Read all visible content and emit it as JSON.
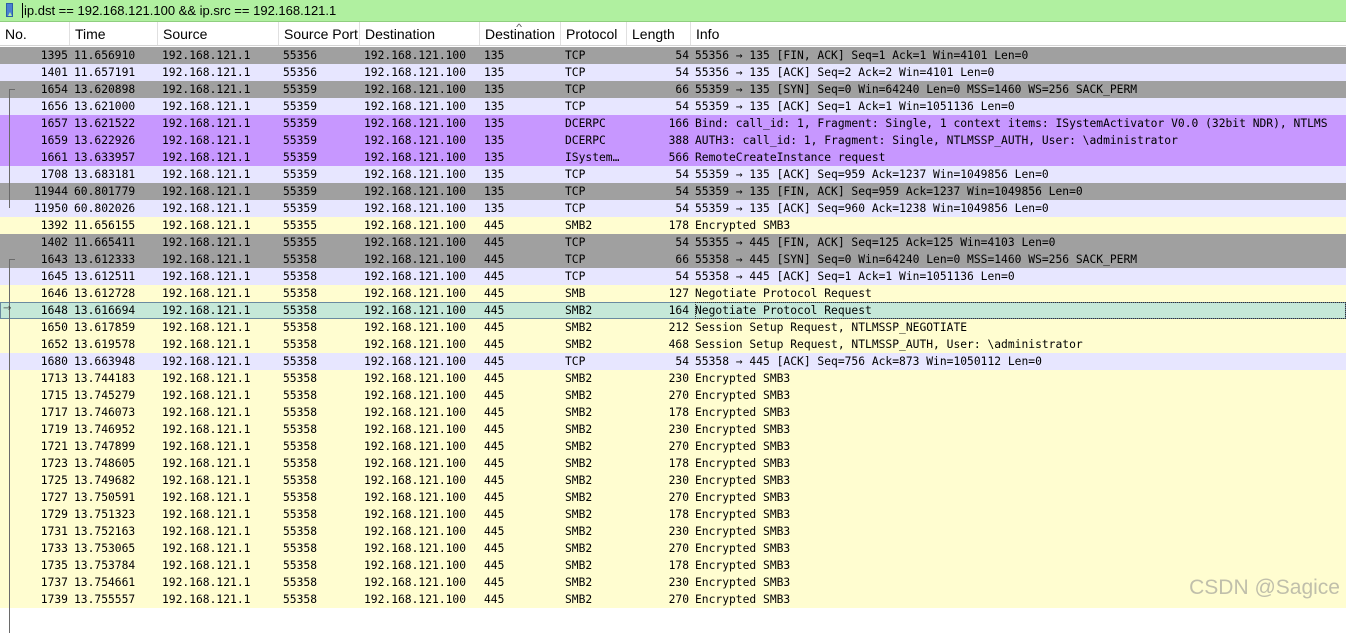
{
  "filter": {
    "text": "ip.dst == 192.168.121.100 && ip.src == 192.168.121.1",
    "icon": "bookmark-filter-icon",
    "background": "#b0f0a0"
  },
  "columns": [
    "No.",
    "Time",
    "Source",
    "Source Port",
    "Destination",
    "Destination",
    "Protocol",
    "Length",
    "Info"
  ],
  "colors": {
    "gray": "#a0a0a0",
    "lavender": "#e7e6ff",
    "purple": "#c797ff",
    "yellow": "#fffdd0",
    "selected": "#c5e8d8"
  },
  "rows": [
    {
      "no": "1395",
      "time": "11.656910",
      "src": "192.168.121.1",
      "sport": "55356",
      "dst": "192.168.121.100",
      "dport": "135",
      "proto": "TCP",
      "len": "54",
      "info": "55356 → 135 [FIN, ACK] Seq=1 Ack=1 Win=4101 Len=0",
      "color": "#a0a0a0"
    },
    {
      "no": "1401",
      "time": "11.657191",
      "src": "192.168.121.1",
      "sport": "55356",
      "dst": "192.168.121.100",
      "dport": "135",
      "proto": "TCP",
      "len": "54",
      "info": "55356 → 135 [ACK] Seq=2 Ack=2 Win=4101 Len=0",
      "color": "#e7e6ff"
    },
    {
      "no": "1654",
      "time": "13.620898",
      "src": "192.168.121.1",
      "sport": "55359",
      "dst": "192.168.121.100",
      "dport": "135",
      "proto": "TCP",
      "len": "66",
      "info": "55359 → 135 [SYN] Seq=0 Win=64240 Len=0 MSS=1460 WS=256 SACK_PERM",
      "color": "#a0a0a0"
    },
    {
      "no": "1656",
      "time": "13.621000",
      "src": "192.168.121.1",
      "sport": "55359",
      "dst": "192.168.121.100",
      "dport": "135",
      "proto": "TCP",
      "len": "54",
      "info": "55359 → 135 [ACK] Seq=1 Ack=1 Win=1051136 Len=0",
      "color": "#e7e6ff"
    },
    {
      "no": "1657",
      "time": "13.621522",
      "src": "192.168.121.1",
      "sport": "55359",
      "dst": "192.168.121.100",
      "dport": "135",
      "proto": "DCERPC",
      "len": "166",
      "info": "Bind: call_id: 1, Fragment: Single, 1 context items: ISystemActivator V0.0 (32bit NDR), NTLMS",
      "color": "#c797ff"
    },
    {
      "no": "1659",
      "time": "13.622926",
      "src": "192.168.121.1",
      "sport": "55359",
      "dst": "192.168.121.100",
      "dport": "135",
      "proto": "DCERPC",
      "len": "388",
      "info": "AUTH3: call_id: 1, Fragment: Single, NTLMSSP_AUTH, User: \\administrator",
      "color": "#c797ff"
    },
    {
      "no": "1661",
      "time": "13.633957",
      "src": "192.168.121.1",
      "sport": "55359",
      "dst": "192.168.121.100",
      "dport": "135",
      "proto": "ISystem…",
      "len": "566",
      "info": "RemoteCreateInstance request",
      "color": "#c797ff"
    },
    {
      "no": "1708",
      "time": "13.683181",
      "src": "192.168.121.1",
      "sport": "55359",
      "dst": "192.168.121.100",
      "dport": "135",
      "proto": "TCP",
      "len": "54",
      "info": "55359 → 135 [ACK] Seq=959 Ack=1237 Win=1049856 Len=0",
      "color": "#e7e6ff"
    },
    {
      "no": "11944",
      "time": "60.801779",
      "src": "192.168.121.1",
      "sport": "55359",
      "dst": "192.168.121.100",
      "dport": "135",
      "proto": "TCP",
      "len": "54",
      "info": "55359 → 135 [FIN, ACK] Seq=959 Ack=1237 Win=1049856 Len=0",
      "color": "#a0a0a0"
    },
    {
      "no": "11950",
      "time": "60.802026",
      "src": "192.168.121.1",
      "sport": "55359",
      "dst": "192.168.121.100",
      "dport": "135",
      "proto": "TCP",
      "len": "54",
      "info": "55359 → 135 [ACK] Seq=960 Ack=1238 Win=1049856 Len=0",
      "color": "#e7e6ff"
    },
    {
      "no": "1392",
      "time": "11.656155",
      "src": "192.168.121.1",
      "sport": "55355",
      "dst": "192.168.121.100",
      "dport": "445",
      "proto": "SMB2",
      "len": "178",
      "info": "Encrypted SMB3",
      "color": "#fffdd0"
    },
    {
      "no": "1402",
      "time": "11.665411",
      "src": "192.168.121.1",
      "sport": "55355",
      "dst": "192.168.121.100",
      "dport": "445",
      "proto": "TCP",
      "len": "54",
      "info": "55355 → 445 [FIN, ACK] Seq=125 Ack=125 Win=4103 Len=0",
      "color": "#a0a0a0"
    },
    {
      "no": "1643",
      "time": "13.612333",
      "src": "192.168.121.1",
      "sport": "55358",
      "dst": "192.168.121.100",
      "dport": "445",
      "proto": "TCP",
      "len": "66",
      "info": "55358 → 445 [SYN] Seq=0 Win=64240 Len=0 MSS=1460 WS=256 SACK_PERM",
      "color": "#a0a0a0"
    },
    {
      "no": "1645",
      "time": "13.612511",
      "src": "192.168.121.1",
      "sport": "55358",
      "dst": "192.168.121.100",
      "dport": "445",
      "proto": "TCP",
      "len": "54",
      "info": "55358 → 445 [ACK] Seq=1 Ack=1 Win=1051136 Len=0",
      "color": "#e7e6ff"
    },
    {
      "no": "1646",
      "time": "13.612728",
      "src": "192.168.121.1",
      "sport": "55358",
      "dst": "192.168.121.100",
      "dport": "445",
      "proto": "SMB",
      "len": "127",
      "info": "Negotiate Protocol Request",
      "color": "#fffdd0"
    },
    {
      "no": "1648",
      "time": "13.616694",
      "src": "192.168.121.1",
      "sport": "55358",
      "dst": "192.168.121.100",
      "dport": "445",
      "proto": "SMB2",
      "len": "164",
      "info": "Negotiate Protocol Request",
      "color": "#c5e8d8",
      "selected": true
    },
    {
      "no": "1650",
      "time": "13.617859",
      "src": "192.168.121.1",
      "sport": "55358",
      "dst": "192.168.121.100",
      "dport": "445",
      "proto": "SMB2",
      "len": "212",
      "info": "Session Setup Request, NTLMSSP_NEGOTIATE",
      "color": "#fffdd0"
    },
    {
      "no": "1652",
      "time": "13.619578",
      "src": "192.168.121.1",
      "sport": "55358",
      "dst": "192.168.121.100",
      "dport": "445",
      "proto": "SMB2",
      "len": "468",
      "info": "Session Setup Request, NTLMSSP_AUTH, User: \\administrator",
      "color": "#fffdd0"
    },
    {
      "no": "1680",
      "time": "13.663948",
      "src": "192.168.121.1",
      "sport": "55358",
      "dst": "192.168.121.100",
      "dport": "445",
      "proto": "TCP",
      "len": "54",
      "info": "55358 → 445 [ACK] Seq=756 Ack=873 Win=1050112 Len=0",
      "color": "#e7e6ff"
    },
    {
      "no": "1713",
      "time": "13.744183",
      "src": "192.168.121.1",
      "sport": "55358",
      "dst": "192.168.121.100",
      "dport": "445",
      "proto": "SMB2",
      "len": "230",
      "info": "Encrypted SMB3",
      "color": "#fffdd0"
    },
    {
      "no": "1715",
      "time": "13.745279",
      "src": "192.168.121.1",
      "sport": "55358",
      "dst": "192.168.121.100",
      "dport": "445",
      "proto": "SMB2",
      "len": "270",
      "info": "Encrypted SMB3",
      "color": "#fffdd0"
    },
    {
      "no": "1717",
      "time": "13.746073",
      "src": "192.168.121.1",
      "sport": "55358",
      "dst": "192.168.121.100",
      "dport": "445",
      "proto": "SMB2",
      "len": "178",
      "info": "Encrypted SMB3",
      "color": "#fffdd0"
    },
    {
      "no": "1719",
      "time": "13.746952",
      "src": "192.168.121.1",
      "sport": "55358",
      "dst": "192.168.121.100",
      "dport": "445",
      "proto": "SMB2",
      "len": "230",
      "info": "Encrypted SMB3",
      "color": "#fffdd0"
    },
    {
      "no": "1721",
      "time": "13.747899",
      "src": "192.168.121.1",
      "sport": "55358",
      "dst": "192.168.121.100",
      "dport": "445",
      "proto": "SMB2",
      "len": "270",
      "info": "Encrypted SMB3",
      "color": "#fffdd0"
    },
    {
      "no": "1723",
      "time": "13.748605",
      "src": "192.168.121.1",
      "sport": "55358",
      "dst": "192.168.121.100",
      "dport": "445",
      "proto": "SMB2",
      "len": "178",
      "info": "Encrypted SMB3",
      "color": "#fffdd0"
    },
    {
      "no": "1725",
      "time": "13.749682",
      "src": "192.168.121.1",
      "sport": "55358",
      "dst": "192.168.121.100",
      "dport": "445",
      "proto": "SMB2",
      "len": "230",
      "info": "Encrypted SMB3",
      "color": "#fffdd0"
    },
    {
      "no": "1727",
      "time": "13.750591",
      "src": "192.168.121.1",
      "sport": "55358",
      "dst": "192.168.121.100",
      "dport": "445",
      "proto": "SMB2",
      "len": "270",
      "info": "Encrypted SMB3",
      "color": "#fffdd0"
    },
    {
      "no": "1729",
      "time": "13.751323",
      "src": "192.168.121.1",
      "sport": "55358",
      "dst": "192.168.121.100",
      "dport": "445",
      "proto": "SMB2",
      "len": "178",
      "info": "Encrypted SMB3",
      "color": "#fffdd0"
    },
    {
      "no": "1731",
      "time": "13.752163",
      "src": "192.168.121.1",
      "sport": "55358",
      "dst": "192.168.121.100",
      "dport": "445",
      "proto": "SMB2",
      "len": "230",
      "info": "Encrypted SMB3",
      "color": "#fffdd0"
    },
    {
      "no": "1733",
      "time": "13.753065",
      "src": "192.168.121.1",
      "sport": "55358",
      "dst": "192.168.121.100",
      "dport": "445",
      "proto": "SMB2",
      "len": "270",
      "info": "Encrypted SMB3",
      "color": "#fffdd0"
    },
    {
      "no": "1735",
      "time": "13.753784",
      "src": "192.168.121.1",
      "sport": "55358",
      "dst": "192.168.121.100",
      "dport": "445",
      "proto": "SMB2",
      "len": "178",
      "info": "Encrypted SMB3",
      "color": "#fffdd0"
    },
    {
      "no": "1737",
      "time": "13.754661",
      "src": "192.168.121.1",
      "sport": "55358",
      "dst": "192.168.121.100",
      "dport": "445",
      "proto": "SMB2",
      "len": "230",
      "info": "Encrypted SMB3",
      "color": "#fffdd0"
    },
    {
      "no": "1739",
      "time": "13.755557",
      "src": "192.168.121.1",
      "sport": "55358",
      "dst": "192.168.121.100",
      "dport": "445",
      "proto": "SMB2",
      "len": "270",
      "info": "Encrypted SMB3",
      "color": "#fffdd0"
    }
  ],
  "watermark": "CSDN @Sagice"
}
